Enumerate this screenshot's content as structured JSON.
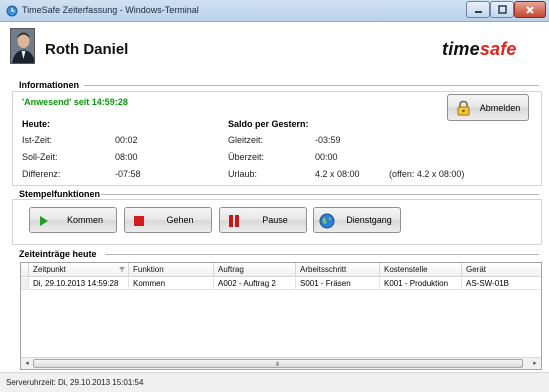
{
  "window": {
    "title": "TimeSafe Zeiterfassung - Windows-Terminal",
    "controls": {
      "minimize": "minimize-icon",
      "maximize": "maximize-icon",
      "close": "close-icon"
    }
  },
  "header": {
    "user_name": "Roth Daniel",
    "logo_part1": "time",
    "logo_part2": "safe",
    "logo_color": "#e2231a"
  },
  "info": {
    "section_title": "Informationen",
    "status": "'Anwesend' seit 14:59:28",
    "status_color": "#0a9a0a",
    "logout_label": "Abmelden",
    "today_title": "Heute:",
    "today_rows": [
      {
        "label": "Ist-Zeit:",
        "value": "00:02"
      },
      {
        "label": "Soll-Zeit:",
        "value": "08:00"
      },
      {
        "label": "Differenz:",
        "value": "-07:58"
      }
    ],
    "saldo_title": "Saldo per Gestern:",
    "saldo_rows": [
      {
        "label": "Gleitzeit:",
        "value": "-03:59",
        "extra": ""
      },
      {
        "label": "Überzeit:",
        "value": "00:00",
        "extra": ""
      },
      {
        "label": "Urlaub:",
        "value": "4.2 x 08:00",
        "extra": "(offen: 4.2 x 08:00)"
      }
    ]
  },
  "stamp": {
    "section_title": "Stempelfunktionen",
    "buttons": [
      {
        "label": "Kommen",
        "icon": "play-icon"
      },
      {
        "label": "Gehen",
        "icon": "stop-icon"
      },
      {
        "label": "Pause",
        "icon": "pause-icon"
      },
      {
        "label": "Dienstgang",
        "icon": "globe-icon"
      }
    ]
  },
  "entries": {
    "section_title": "Zeiteinträge heute",
    "columns": [
      "Zeitpunkt",
      "Funktion",
      "Auftrag",
      "Arbeitsschritt",
      "Kostenstelle",
      "Gerät"
    ],
    "rows": [
      [
        "Di, 29.10.2013 14:59:28",
        "Kommen",
        "A002 - Auftrag 2",
        "S001 - Fräsen",
        "K001 - Produktion",
        "AS-SW-01B"
      ]
    ],
    "scroll_grip": "III"
  },
  "statusbar": {
    "text": "Serveruhrzeit: Di, 29.10.2013 15:01:54"
  }
}
